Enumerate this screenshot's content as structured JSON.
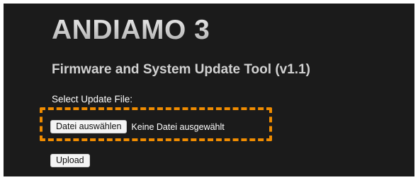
{
  "app": {
    "title": "ANDIAMO 3",
    "subtitle": "Firmware and System Update Tool (v1.1)"
  },
  "form": {
    "file_label": "Select Update File:",
    "choose_button_label": "Datei auswählen",
    "file_status": "Keine Datei ausgewählt",
    "upload_button_label": "Upload"
  },
  "colors": {
    "background": "#1b1b1b",
    "highlight": "#f08c00",
    "title": "#c9c9c9"
  }
}
